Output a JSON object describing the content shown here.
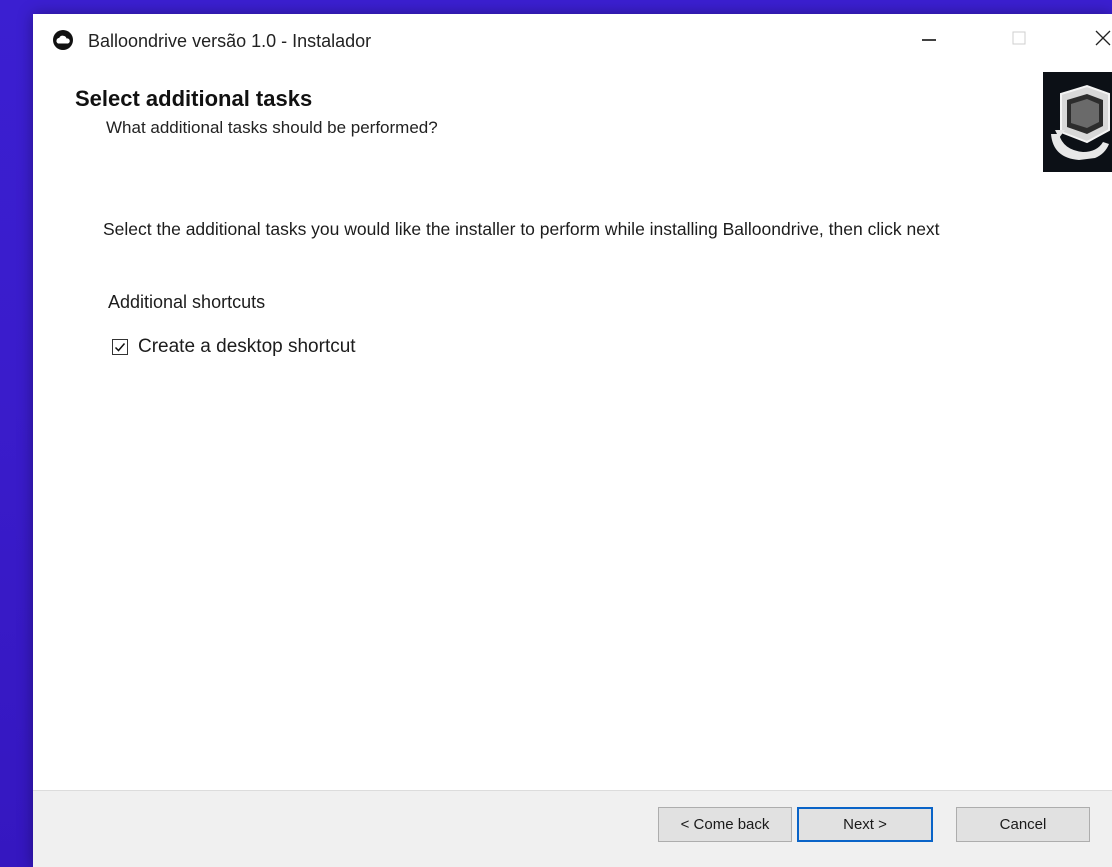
{
  "window": {
    "title": "Balloondrive versão 1.0 - Instalador",
    "app_icon": "cloud-icon"
  },
  "titlebar_controls": {
    "minimize_icon": "minimize-icon",
    "maximize_icon": "maximize-icon",
    "close_icon": "close-icon"
  },
  "header": {
    "title": "Select additional tasks",
    "subtitle": "What additional tasks should be performed?",
    "graphic_icon": "installer-computer-icon"
  },
  "body": {
    "instructions": "Select the additional tasks you would like the installer to perform while installing Balloondrive, then click next",
    "group_label": "Additional shortcuts",
    "tasks": [
      {
        "label": "Create a desktop shortcut",
        "checked": true
      }
    ]
  },
  "footer": {
    "back_label": "< Come back",
    "next_label": "Next >",
    "cancel_label": "Cancel"
  },
  "colors": {
    "background": "#3a1ccb",
    "window": "#ffffff",
    "footer": "#f0f0f0",
    "default_button_border": "#0a64c8"
  }
}
